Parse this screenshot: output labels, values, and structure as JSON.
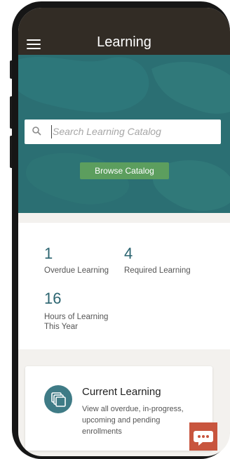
{
  "header": {
    "title": "Learning"
  },
  "search": {
    "placeholder": "Search Learning Catalog"
  },
  "browse": {
    "label": "Browse Catalog"
  },
  "stats": [
    {
      "value": "1",
      "label": "Overdue Learning"
    },
    {
      "value": "4",
      "label": "Required Learning"
    },
    {
      "value": "16",
      "label_line1": "Hours of Learning",
      "label_line2": "This Year"
    }
  ],
  "current_learning": {
    "title": "Current Learning",
    "line1": "View all overdue, in-progress,",
    "line2": "upcoming and pending",
    "line3": "enrollments"
  },
  "colors": {
    "header": "#322c25",
    "hero": "#2b6f73",
    "accent_button": "#5c9e5e",
    "stat_number": "#2b6470",
    "chat_button": "#c8553e"
  },
  "icons": {
    "menu": "hamburger-menu-icon",
    "search": "magnifier-icon",
    "card": "stacked-cards-icon",
    "chat": "chat-bubble-icon"
  }
}
